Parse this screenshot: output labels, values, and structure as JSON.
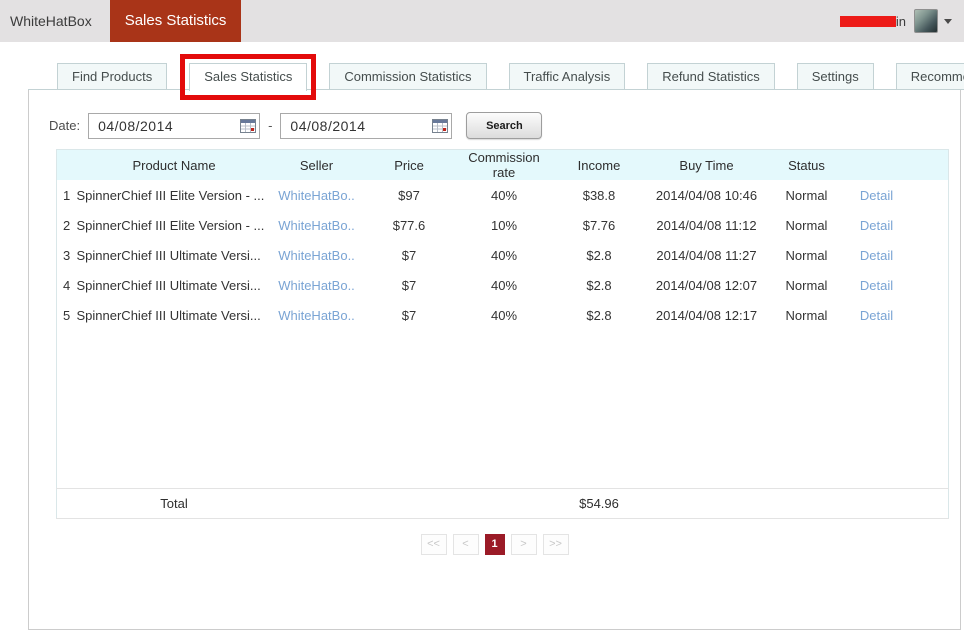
{
  "topbar": {
    "brand": "WhiteHatBox",
    "active_item": "Sales Statistics",
    "user_suffix": "in"
  },
  "tabs": [
    "Find Products",
    "Sales Statistics",
    "Commission Statistics",
    "Traffic Analysis",
    "Refund Statistics",
    "Settings",
    "Recommended View"
  ],
  "filter": {
    "date_label": "Date:",
    "date_from": "04/08/2014",
    "date_separator": "-",
    "date_to": "04/08/2014",
    "search_label": "Search"
  },
  "table": {
    "headers": {
      "product": "Product Name",
      "seller": "Seller",
      "price": "Price",
      "rate": "Commission rate",
      "income": "Income",
      "buy_time": "Buy Time",
      "status": "Status"
    },
    "rows": [
      {
        "num": "1",
        "product": "SpinnerChief III Elite Version - ...",
        "seller": "WhiteHatBo..",
        "price": "$97",
        "rate": "40%",
        "income": "$38.8",
        "buy_time": "2014/04/08 10:46",
        "status": "Normal",
        "detail": "Detail"
      },
      {
        "num": "2",
        "product": "SpinnerChief III Elite Version - ...",
        "seller": "WhiteHatBo..",
        "price": "$77.6",
        "rate": "10%",
        "income": "$7.76",
        "buy_time": "2014/04/08 11:12",
        "status": "Normal",
        "detail": "Detail"
      },
      {
        "num": "3",
        "product": "SpinnerChief III Ultimate Versi...",
        "seller": "WhiteHatBo..",
        "price": "$7",
        "rate": "40%",
        "income": "$2.8",
        "buy_time": "2014/04/08 11:27",
        "status": "Normal",
        "detail": "Detail"
      },
      {
        "num": "4",
        "product": "SpinnerChief III Ultimate Versi...",
        "seller": "WhiteHatBo..",
        "price": "$7",
        "rate": "40%",
        "income": "$2.8",
        "buy_time": "2014/04/08 12:07",
        "status": "Normal",
        "detail": "Detail"
      },
      {
        "num": "5",
        "product": "SpinnerChief III Ultimate Versi...",
        "seller": "WhiteHatBo..",
        "price": "$7",
        "rate": "40%",
        "income": "$2.8",
        "buy_time": "2014/04/08 12:17",
        "status": "Normal",
        "detail": "Detail"
      }
    ],
    "total_label": "Total",
    "total_income": "$54.96"
  },
  "pagination": {
    "first": "<<",
    "prev": "<",
    "current": "1",
    "next": ">",
    "last": ">>"
  },
  "colors": {
    "topbar_bg": "#e3e1e2",
    "brand_red": "#a93418",
    "annotation_red": "#e30b0b",
    "table_header_bg": "#e4f9fc",
    "link_blue": "#7aa4d4",
    "pagination_active_red": "#9b1b27",
    "redaction_red": "#ed1b18"
  }
}
